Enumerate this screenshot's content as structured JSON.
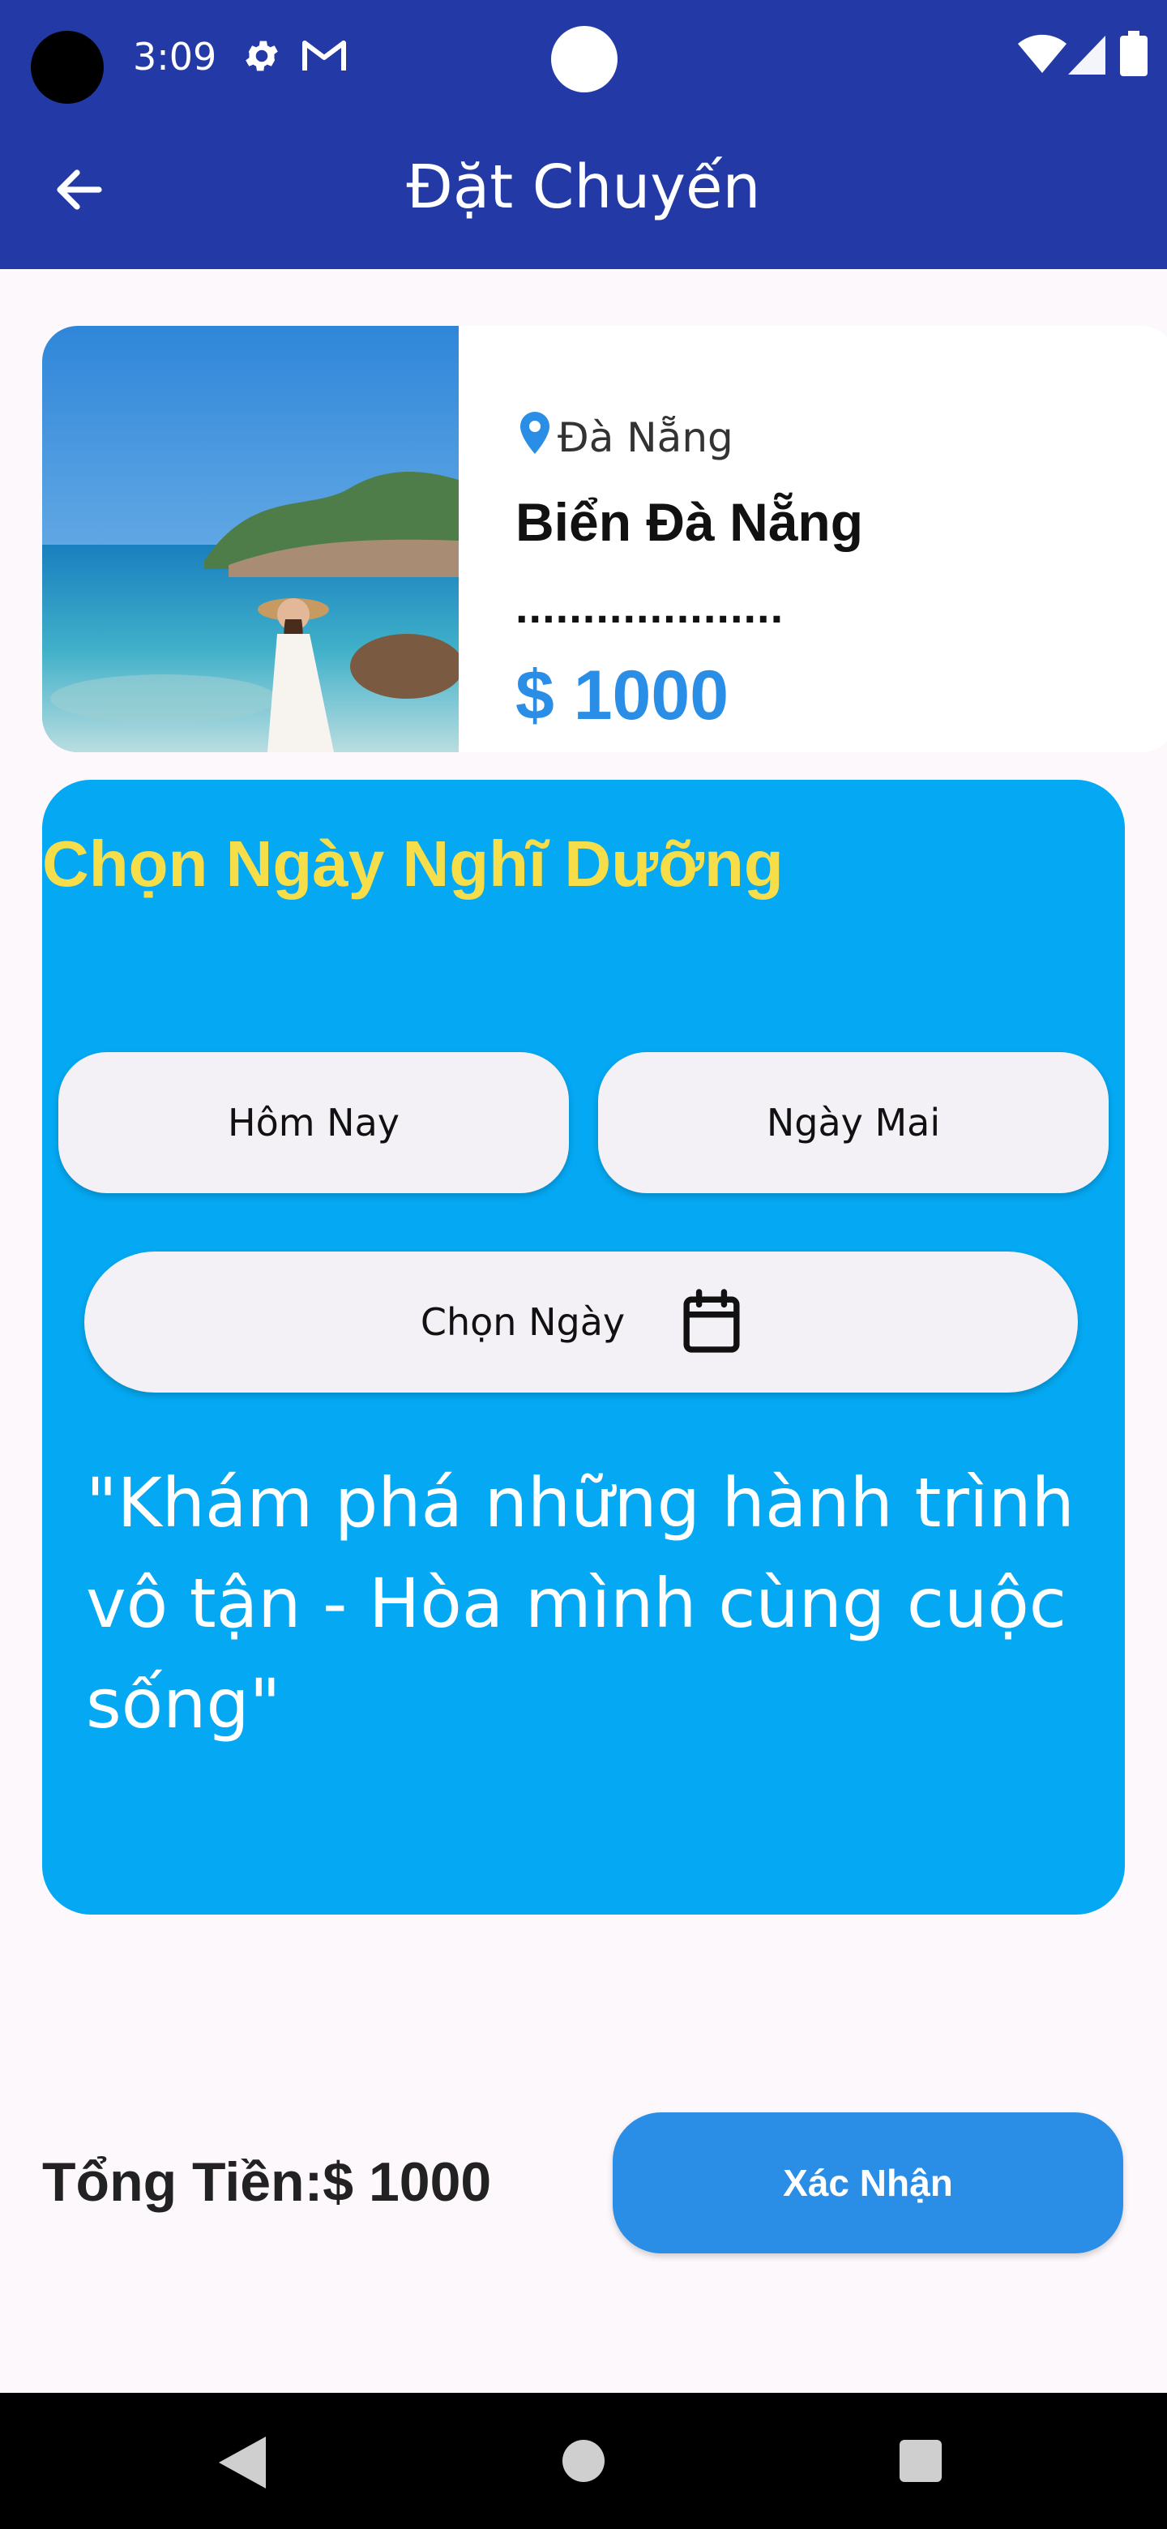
{
  "status_bar": {
    "time": "3:09",
    "icons": [
      "gear-icon",
      "gmail-icon",
      "wifi-icon",
      "signal-icon",
      "battery-icon"
    ]
  },
  "app_bar": {
    "title": "Đặt Chuyến",
    "back_icon": "arrow-left-icon"
  },
  "destination": {
    "location": "Đà Nẵng",
    "name": "Biển Đà Nẵng",
    "rating": "....................",
    "price": "$ 1000",
    "image_subject": "woman in white dress and straw hat standing in clear sea water near rocky island"
  },
  "date_panel": {
    "title": "Chọn Ngày Nghĩ Dưỡng",
    "today_label": "Hôm Nay",
    "tomorrow_label": "Ngày Mai",
    "pick_date_label": "Chọn Ngày",
    "slogan": "\"Khám phá những hành trình vô tận - Hòa mình cùng cuộc sống\""
  },
  "footer": {
    "total": "Tổng Tiền:$ 1000",
    "confirm_label": "Xác Nhận"
  },
  "colors": {
    "app_bar": "#233aa6",
    "panel": "#05a8f2",
    "panel_title": "#f6dd4a",
    "price": "#2a8ee6",
    "confirm_button": "#2a8ee6",
    "background": "#fdf8fc"
  }
}
